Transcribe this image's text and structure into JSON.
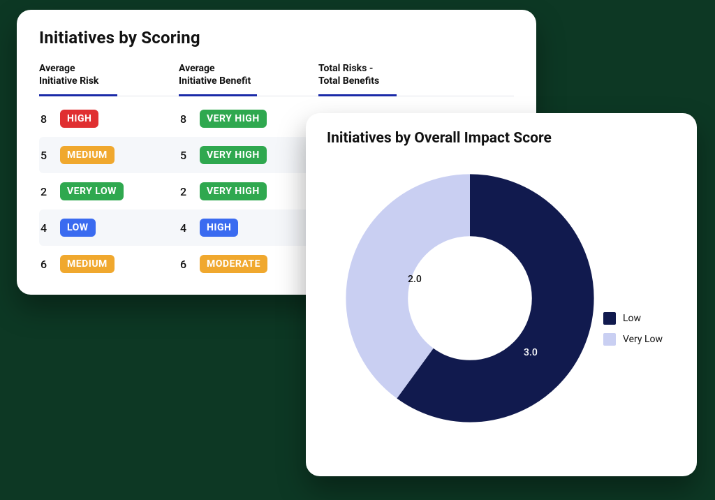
{
  "scoring": {
    "title": "Initiatives by Scoring",
    "columns": {
      "risk": {
        "line1": "Average",
        "line2": "Initiative Risk"
      },
      "benefit": {
        "line1": "Average",
        "line2": "Initiative Benefit"
      },
      "diff": {
        "line1": "Total Risks -",
        "line2": "Total Benefits"
      }
    },
    "rows": [
      {
        "risk_value": "8",
        "risk_label": "HIGH",
        "risk_color": "red",
        "benefit_value": "8",
        "benefit_label": "VERY HIGH",
        "benefit_color": "green"
      },
      {
        "risk_value": "5",
        "risk_label": "MEDIUM",
        "risk_color": "orange",
        "benefit_value": "5",
        "benefit_label": "VERY HIGH",
        "benefit_color": "green"
      },
      {
        "risk_value": "2",
        "risk_label": "VERY LOW",
        "risk_color": "green",
        "benefit_value": "2",
        "benefit_label": "VERY HIGH",
        "benefit_color": "green"
      },
      {
        "risk_value": "4",
        "risk_label": "LOW",
        "risk_color": "blue",
        "benefit_value": "4",
        "benefit_label": "HIGH",
        "benefit_color": "blue"
      },
      {
        "risk_value": "6",
        "risk_label": "MEDIUM",
        "risk_color": "orange",
        "benefit_value": "6",
        "benefit_label": "MODERATE",
        "benefit_color": "orange"
      }
    ]
  },
  "impact": {
    "title": "Initiatives by Overall Impact Score",
    "legend": {
      "low": "Low",
      "very_low": "Very Low"
    },
    "label_low": "3.0",
    "label_very_low": "2.0",
    "colors": {
      "low": "#111a4e",
      "very_low": "#c9cff2"
    }
  },
  "chart_data": {
    "type": "pie",
    "title": "Initiatives by Overall Impact Score",
    "series": [
      {
        "name": "Low",
        "value": 3.0,
        "color": "#111a4e"
      },
      {
        "name": "Very Low",
        "value": 2.0,
        "color": "#c9cff2"
      }
    ],
    "donut": true
  }
}
